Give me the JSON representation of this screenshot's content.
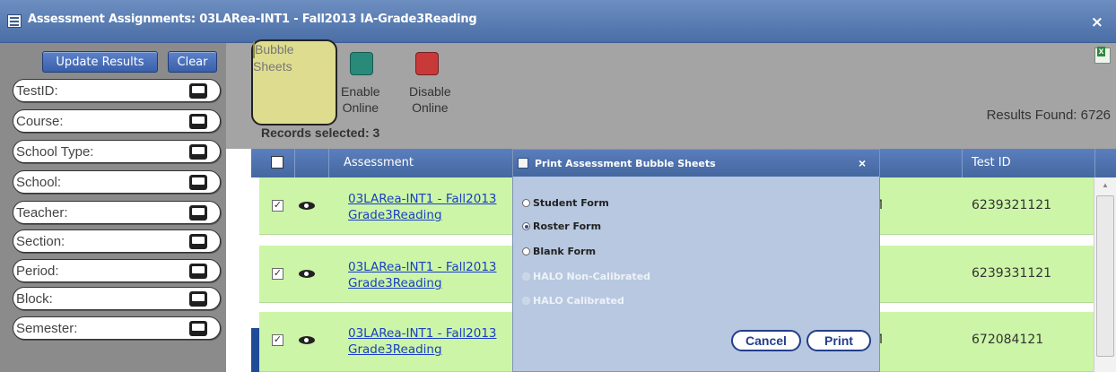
{
  "window": {
    "title": "Assessment Assignments: 03LARea-INT1 - Fall2013 IA-Grade3Reading",
    "close": "×"
  },
  "sidebar": {
    "update_label": "Update Results",
    "clear_label": "Clear",
    "filters": [
      {
        "label": "TestID:",
        "icon": "comment-icon"
      },
      {
        "label": "Course:",
        "icon": "comment-icon"
      },
      {
        "label": "School Type:",
        "icon": "comment-icon"
      },
      {
        "label": "School:",
        "icon": "comment-icon"
      },
      {
        "label": "Teacher:",
        "icon": "comment-icon"
      },
      {
        "label": "Section:",
        "icon": "comment-icon"
      },
      {
        "label": "Period:",
        "icon": "comment-icon"
      },
      {
        "label": "Block:",
        "icon": "comment-icon"
      },
      {
        "label": "Semester:",
        "icon": "comment-icon"
      }
    ]
  },
  "toolbar": {
    "bubble_label": "Bubble\nSheets",
    "enable_label": "Enable\nOnline",
    "disable_label": "Disable\nOnline",
    "records_selected": "Records selected: 3",
    "results_found": "Results Found: 6726",
    "colors": {
      "bubble": "#e6e07a",
      "enable": "#2a8a7a",
      "disable": "#c83a3a",
      "highlight": "#dedc8e"
    }
  },
  "grid": {
    "columns": {
      "assessment": "Assessment",
      "test_id": "Test ID"
    },
    "rows": [
      {
        "assessment": "03LARea-INT1 - Fall2013\nGrade3Reading",
        "clipped": "M",
        "test_id": "6239321121",
        "checked": "✓"
      },
      {
        "assessment": "03LARea-INT1 - Fall2013\nGrade3Reading",
        "clipped": "",
        "test_id": "6239331121",
        "checked": "✓"
      },
      {
        "assessment": "03LARea-INT1 - Fall2013\nGrade3Reading",
        "clipped": "M",
        "test_id": "672084121",
        "checked": "✓"
      }
    ],
    "row_color": "#ccf5a7"
  },
  "modal": {
    "title": "Print Assessment Bubble Sheets",
    "close": "×",
    "options": [
      {
        "label": "Student Form",
        "selected": false,
        "enabled": true
      },
      {
        "label": "Roster Form",
        "selected": true,
        "enabled": true
      },
      {
        "label": "Blank Form",
        "selected": false,
        "enabled": true
      },
      {
        "label": "HALO Non-Calibrated",
        "selected": false,
        "enabled": false
      },
      {
        "label": "HALO Calibrated",
        "selected": false,
        "enabled": false
      }
    ],
    "cancel_label": "Cancel",
    "print_label": "Print"
  }
}
